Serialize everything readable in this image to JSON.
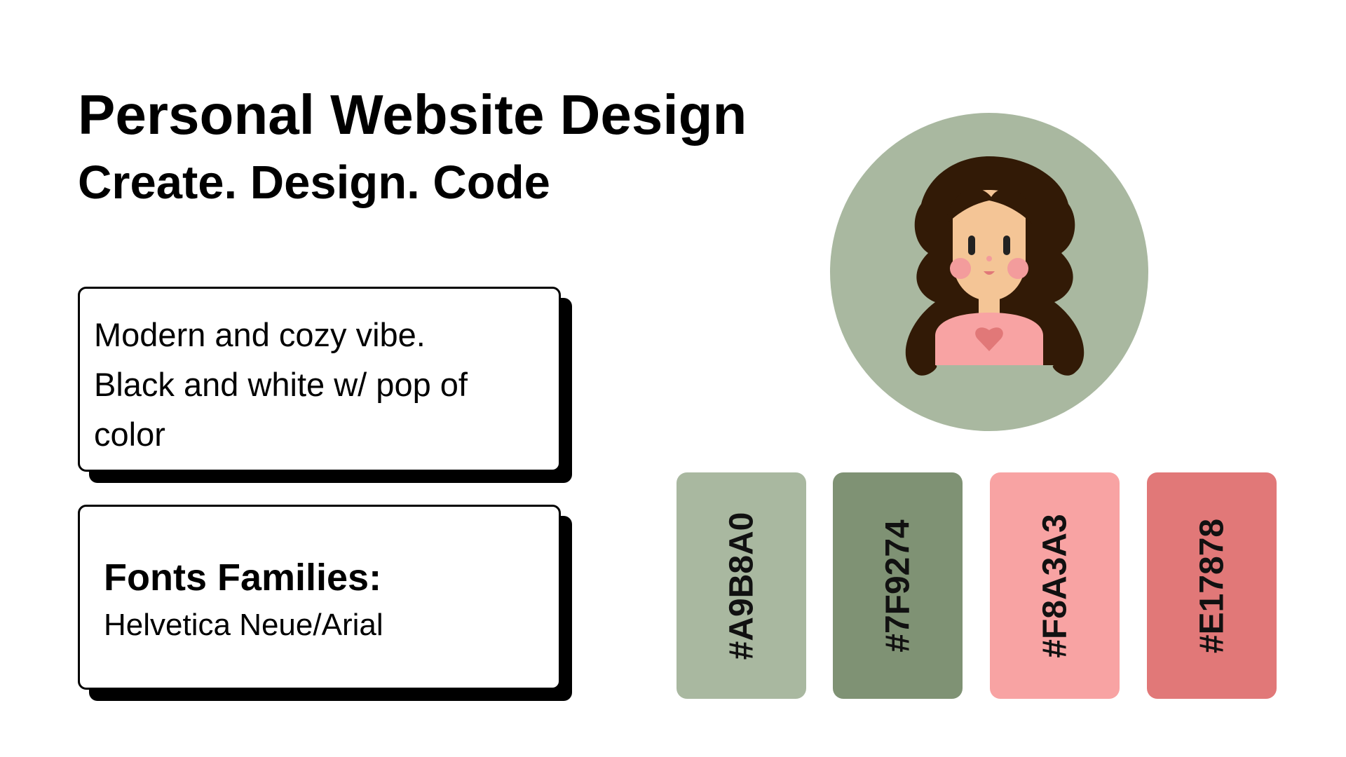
{
  "header": {
    "title": "Personal Website Design",
    "subtitle": "Create. Design. Code"
  },
  "vibe_card": {
    "lines": [
      "Modern and cozy vibe.",
      "Black and white w/ pop of color"
    ]
  },
  "fonts_card": {
    "heading": "Fonts Families:",
    "value": "Helvetica Neue/Arial"
  },
  "avatar": {
    "icon": "woman-avatar-icon",
    "background": "#A9B8A0"
  },
  "palette": [
    {
      "label": "#A9B8A0",
      "color": "#A9B8A0"
    },
    {
      "label": "#7F9274",
      "color": "#7F9274"
    },
    {
      "label": "#F8A3A3",
      "color": "#F8A3A3"
    },
    {
      "label": "#E17878",
      "color": "#E17878"
    }
  ]
}
